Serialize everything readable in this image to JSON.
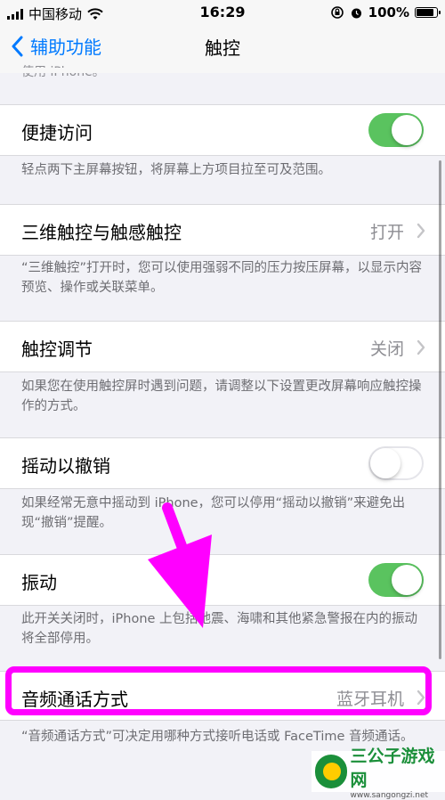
{
  "status_bar": {
    "carrier": "中国移动",
    "time": "16:29",
    "battery": "100%",
    "icons": [
      "signal-icon",
      "wifi-icon",
      "rotation-lock-icon",
      "alarm-icon",
      "battery-icon"
    ]
  },
  "nav": {
    "back_label": "辅助功能",
    "title": "触控"
  },
  "clipped_footer": "使用 iPhone。",
  "settings": [
    {
      "label": "便捷访问",
      "control": "toggle",
      "on": true,
      "footer": "轻点两下主屏幕按钮，将屏幕上方项目拉至可及范围。"
    },
    {
      "label": "三维触控与触感触控",
      "control": "value",
      "value": "打开",
      "footer": "“三维触控”打开时，您可以使用强弱不同的压力按压屏幕，以显示内容预览、操作或关联菜单。"
    },
    {
      "label": "触控调节",
      "control": "value",
      "value": "关闭",
      "footer": "如果您在使用触控屏时遇到问题，请调整以下设置更改屏幕响应触控操作的方式。"
    },
    {
      "label": "摇动以撤销",
      "control": "toggle",
      "on": false,
      "footer": "如果经常无意中摇动到 iPhone，您可以停用“摇动以撤销”来避免出现“撤销”提醒。"
    },
    {
      "label": "振动",
      "control": "toggle",
      "on": true,
      "footer": "此开关关闭时，iPhone 上包括地震、海啸和其他紧急警报在内的振动将全部停用。"
    },
    {
      "label": "音频通话方式",
      "control": "value",
      "value": "蓝牙耳机",
      "footer": "“音频通话方式”可决定用哪种方式接听电话或 FaceTime 音频通话。"
    }
  ],
  "colors": {
    "accent": "#007aff",
    "toggle_on": "#5ac35f",
    "annotation": "#ff00ff"
  },
  "watermark": {
    "name": "三公子游戏网",
    "url": "www.sangongzi.net"
  }
}
